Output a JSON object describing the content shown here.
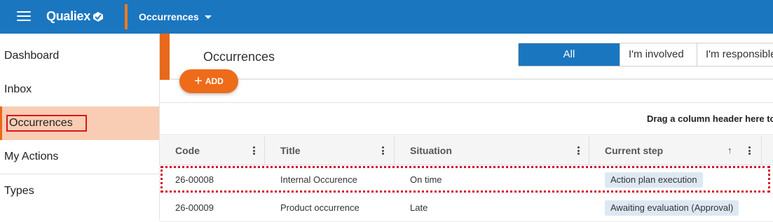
{
  "app": {
    "brand": "Qualiex",
    "module": "Occurrences"
  },
  "sidebar": {
    "items": [
      {
        "label": "Dashboard"
      },
      {
        "label": "Inbox"
      },
      {
        "label": "Occurrences"
      },
      {
        "label": "My Actions"
      },
      {
        "label": "Types"
      }
    ]
  },
  "main": {
    "title": "Occurrences",
    "filters": [
      "All",
      "I'm involved",
      "I'm responsible"
    ],
    "active_filter": "All",
    "add_label": "ADD"
  },
  "grid": {
    "group_hint": "Drag a column header here to",
    "columns": [
      "Code",
      "Title",
      "Situation",
      "Current step"
    ],
    "sorted_column": "Current step",
    "sort_direction": "ascending",
    "rows": [
      {
        "code": "26-00008",
        "title": "Internal Occurence",
        "situation": "On time",
        "step": "Action plan execution"
      },
      {
        "code": "26-00009",
        "title": "Product occurrence",
        "situation": "Late",
        "step": "Awaiting evaluation (Approval)"
      }
    ]
  },
  "colors": {
    "topbar": "#1b76c0",
    "accent": "#e8691a",
    "active_item_bg": "#f8cdb4",
    "highlight": "#d0112b"
  }
}
